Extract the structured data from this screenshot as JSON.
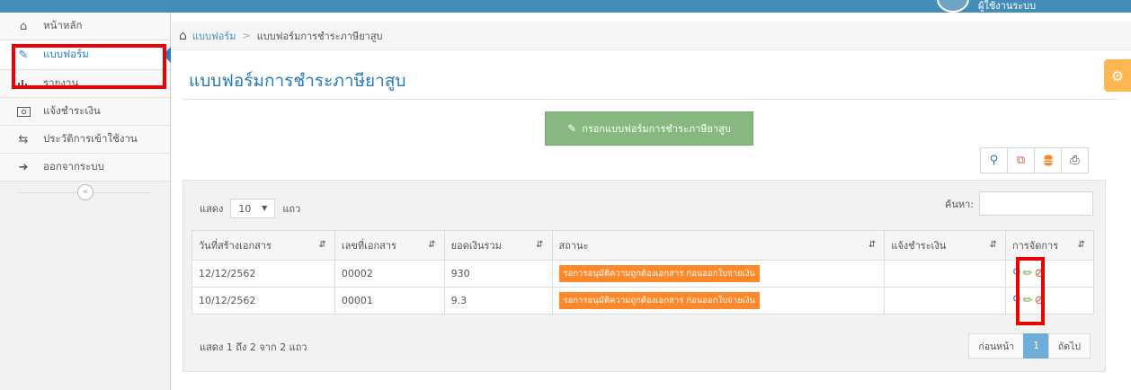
{
  "topbar": {
    "username": "ผู้ใช้งานระบบ"
  },
  "sidebar": {
    "items": [
      {
        "label": "หน้าหลัก",
        "icon": "home-icon"
      },
      {
        "label": "แบบฟอร์ม",
        "icon": "pencil-square-icon",
        "active": true
      },
      {
        "label": "รายงาน",
        "icon": "bar-chart-icon"
      },
      {
        "label": "แจ้งชำระเงิน",
        "icon": "money-icon"
      },
      {
        "label": "ประวัติการเข้าใช้งาน",
        "icon": "exchange-icon"
      },
      {
        "label": "ออกจากระบบ",
        "icon": "sign-out-icon"
      }
    ],
    "collapse_symbol": "«"
  },
  "breadcrumb": {
    "home": "แบบฟอร์ม",
    "separator": ">",
    "current": "แบบฟอร์มการชำระภาษียาสูบ"
  },
  "page": {
    "title": "แบบฟอร์มการชำระภาษียาสูบ"
  },
  "actions": {
    "fill_form_label": "กรอกแบบฟอร์มการชำระภาษียาสูบ"
  },
  "tools": [
    "search-icon",
    "copy-icon",
    "database-icon",
    "print-icon"
  ],
  "table_controls": {
    "show_label": "แสดง",
    "page_size": "10",
    "rows_label": "แถว",
    "search_label": "ค้นหา:"
  },
  "table": {
    "columns": [
      "วันที่สร้างเอกสาร",
      "เลขที่เอกสาร",
      "ยอดเงินรวม",
      "สถานะ",
      "แจ้งชำระเงิน",
      "การจัดการ"
    ],
    "rows": [
      {
        "date": "12/12/2562",
        "doc_no": "00002",
        "total": "930",
        "status": "รอการอนุมัติความถูกต้องเอกสาร ก่อนออกใบจ่ายเงิน",
        "payment": ""
      },
      {
        "date": "10/12/2562",
        "doc_no": "00001",
        "total": "9.3",
        "status": "รอการอนุมัติความถูกต้องเอกสาร ก่อนออกใบจ่ายเงิน",
        "payment": ""
      }
    ]
  },
  "footer": {
    "info": "แสดง 1 ถึง 2 จาก 2 แถว",
    "prev": "ก่อนหน้า",
    "page": "1",
    "next": "ถัดไป"
  },
  "colors": {
    "accent": "#2b7dbc",
    "topbar": "#438eb9",
    "status_badge": "#ff892a",
    "fill_button": "#87b87f",
    "highlight": "#ee0000"
  }
}
